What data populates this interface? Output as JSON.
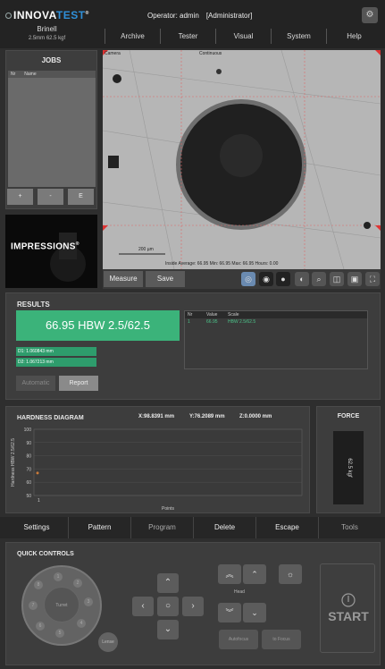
{
  "brand": {
    "logo_prefix": "INNOVA",
    "logo_suffix": "TEST",
    "logo_mark": "®"
  },
  "header": {
    "operator": "Operator: admin",
    "role": "[Administrator]",
    "method": "Brinell",
    "method_sub": "2.5mm 62.5 kgf",
    "top_icon": "settings-icon"
  },
  "menu": [
    "Archive",
    "Tester",
    "Visual",
    "System",
    "Help"
  ],
  "jobs": {
    "title": "JOBS",
    "columns": [
      "Nr",
      "Name"
    ],
    "buttons": [
      "+",
      "-",
      "E"
    ]
  },
  "ad": {
    "text": "IMPRESSIONS",
    "mark": "®"
  },
  "camera": {
    "label": "Camera",
    "status": "Continuous",
    "scale_label": "200 µm",
    "readout": "Inside  Average: 66.95  Min: 66.95  Max: 66.95  Hours: 0.00"
  },
  "toolbar": {
    "measure": "Measure",
    "save": "Save",
    "icons": [
      "live-view-icon",
      "ring-icon",
      "circle-icon",
      "contrast-icon",
      "zoom-icon",
      "camera-icon",
      "snapshot-icon",
      "fullscreen-icon"
    ]
  },
  "results": {
    "title": "RESULTS",
    "hardness": "66.95 HBW 2.5/62.5",
    "d1": "D1: 1.060843 mm",
    "d2": "D2: 1.067213 mm",
    "automatic": "Automatic",
    "report": "Report",
    "table": {
      "headers": [
        "Nr",
        "Value",
        "Scale"
      ],
      "rows": [
        [
          "1",
          "66.95",
          "HBW 2.5/62.5"
        ]
      ]
    }
  },
  "diagram": {
    "title": "HARDNESS DIAGRAM",
    "x": "X:98.8391 mm",
    "y": "Y:76.2089 mm",
    "z": "Z:0.0000  mm",
    "ylabel": "Hardness HBW 2.5/62.5",
    "xlabel": "Points"
  },
  "chart_data": {
    "type": "scatter",
    "x": [
      1
    ],
    "values": [
      66.95
    ],
    "ylim": [
      50,
      100
    ],
    "yticks": [
      100,
      90,
      80,
      70,
      60,
      50
    ],
    "xticks": [
      "1"
    ],
    "ylabel": "Hardness HBW 2.5/62.5",
    "xlabel": "Points",
    "grid": true
  },
  "force": {
    "title": "FORCE",
    "value": "62.5 kgf"
  },
  "bottom_bar": [
    "Settings",
    "Pattern",
    "Program",
    "Delete",
    "Escape",
    "Tools"
  ],
  "quick": {
    "title": "QUICK CONTROLS",
    "dial_center": "Turret",
    "dial_numbers": [
      "1",
      "2",
      "3",
      "4",
      "5",
      "6",
      "7",
      "8"
    ],
    "side_button": "Lense",
    "head_label": "Head",
    "auto_focus": "Autofocus",
    "to_focus": "to Focus",
    "start": "START",
    "colors": {
      "accent_green": "#3bb37a",
      "brand_blue": "#2f8fd8",
      "dot_orange": "#c87a3a"
    }
  }
}
